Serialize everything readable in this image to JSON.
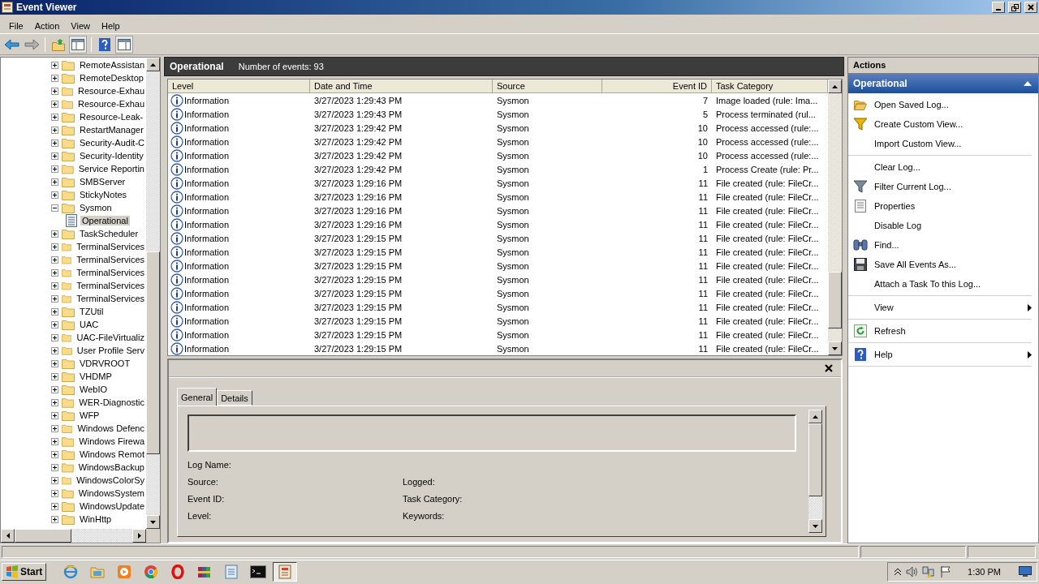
{
  "window": {
    "title": "Event Viewer"
  },
  "menu": [
    "File",
    "Action",
    "View",
    "Help"
  ],
  "tree": {
    "items": [
      {
        "label": "RemoteAssistan",
        "expanded": false,
        "selected": false
      },
      {
        "label": "RemoteDesktop",
        "expanded": false,
        "selected": false
      },
      {
        "label": "Resource-Exhau",
        "expanded": false,
        "selected": false
      },
      {
        "label": "Resource-Exhau",
        "expanded": false,
        "selected": false
      },
      {
        "label": "Resource-Leak-",
        "expanded": false,
        "selected": false
      },
      {
        "label": "RestartManager",
        "expanded": false,
        "selected": false
      },
      {
        "label": "Security-Audit-C",
        "expanded": false,
        "selected": false
      },
      {
        "label": "Security-Identity",
        "expanded": false,
        "selected": false
      },
      {
        "label": "Service Reportin",
        "expanded": false,
        "selected": false
      },
      {
        "label": "SMBServer",
        "expanded": false,
        "selected": false
      },
      {
        "label": "StickyNotes",
        "expanded": false,
        "selected": false
      },
      {
        "label": "Sysmon",
        "expanded": true,
        "selected": false,
        "children": [
          {
            "label": "Operational",
            "selected": true
          }
        ]
      },
      {
        "label": "TaskScheduler",
        "expanded": false,
        "selected": false
      },
      {
        "label": "TerminalServices",
        "expanded": false,
        "selected": false
      },
      {
        "label": "TerminalServices",
        "expanded": false,
        "selected": false
      },
      {
        "label": "TerminalServices",
        "expanded": false,
        "selected": false
      },
      {
        "label": "TerminalServices",
        "expanded": false,
        "selected": false
      },
      {
        "label": "TerminalServices",
        "expanded": false,
        "selected": false
      },
      {
        "label": "TZUtil",
        "expanded": false,
        "selected": false
      },
      {
        "label": "UAC",
        "expanded": false,
        "selected": false
      },
      {
        "label": "UAC-FileVirtualiz",
        "expanded": false,
        "selected": false
      },
      {
        "label": "User Profile Serv",
        "expanded": false,
        "selected": false
      },
      {
        "label": "VDRVROOT",
        "expanded": false,
        "selected": false
      },
      {
        "label": "VHDMP",
        "expanded": false,
        "selected": false
      },
      {
        "label": "WebIO",
        "expanded": false,
        "selected": false
      },
      {
        "label": "WER-Diagnostic",
        "expanded": false,
        "selected": false
      },
      {
        "label": "WFP",
        "expanded": false,
        "selected": false
      },
      {
        "label": "Windows Defenc",
        "expanded": false,
        "selected": false
      },
      {
        "label": "Windows Firewa",
        "expanded": false,
        "selected": false
      },
      {
        "label": "Windows Remot",
        "expanded": false,
        "selected": false
      },
      {
        "label": "WindowsBackup",
        "expanded": false,
        "selected": false
      },
      {
        "label": "WindowsColorSy",
        "expanded": false,
        "selected": false
      },
      {
        "label": "WindowsSystem",
        "expanded": false,
        "selected": false
      },
      {
        "label": "WindowsUpdate",
        "expanded": false,
        "selected": false
      },
      {
        "label": "WinHttp",
        "expanded": false,
        "selected": false
      }
    ]
  },
  "log_header": {
    "title": "Operational",
    "count": "Number of events: 93"
  },
  "table": {
    "columns": [
      "Level",
      "Date and Time",
      "Source",
      "Event ID",
      "Task Category"
    ],
    "rows": [
      {
        "level": "Information",
        "date_time": "3/27/2023 1:29:43 PM",
        "source": "Sysmon",
        "event_id": "7",
        "task_category": "Image loaded (rule: Ima...",
        "selected": false
      },
      {
        "level": "Information",
        "date_time": "3/27/2023 1:29:43 PM",
        "source": "Sysmon",
        "event_id": "5",
        "task_category": "Process terminated (rul...",
        "selected": false
      },
      {
        "level": "Information",
        "date_time": "3/27/2023 1:29:42 PM",
        "source": "Sysmon",
        "event_id": "10",
        "task_category": "Process accessed (rule:...",
        "selected": false
      },
      {
        "level": "Information",
        "date_time": "3/27/2023 1:29:42 PM",
        "source": "Sysmon",
        "event_id": "10",
        "task_category": "Process accessed (rule:...",
        "selected": false
      },
      {
        "level": "Information",
        "date_time": "3/27/2023 1:29:42 PM",
        "source": "Sysmon",
        "event_id": "10",
        "task_category": "Process accessed (rule:...",
        "selected": false
      },
      {
        "level": "Information",
        "date_time": "3/27/2023 1:29:42 PM",
        "source": "Sysmon",
        "event_id": "1",
        "task_category": "Process Create (rule: Pr...",
        "selected": false
      },
      {
        "level": "Information",
        "date_time": "3/27/2023 1:29:16 PM",
        "source": "Sysmon",
        "event_id": "11",
        "task_category": "File created (rule: FileCr...",
        "selected": false
      },
      {
        "level": "Information",
        "date_time": "3/27/2023 1:29:16 PM",
        "source": "Sysmon",
        "event_id": "11",
        "task_category": "File created (rule: FileCr...",
        "selected": false
      },
      {
        "level": "Information",
        "date_time": "3/27/2023 1:29:16 PM",
        "source": "Sysmon",
        "event_id": "11",
        "task_category": "File created (rule: FileCr...",
        "selected": false
      },
      {
        "level": "Information",
        "date_time": "3/27/2023 1:29:16 PM",
        "source": "Sysmon",
        "event_id": "11",
        "task_category": "File created (rule: FileCr...",
        "selected": false
      },
      {
        "level": "Information",
        "date_time": "3/27/2023 1:29:15 PM",
        "source": "Sysmon",
        "event_id": "11",
        "task_category": "File created (rule: FileCr...",
        "selected": false
      },
      {
        "level": "Information",
        "date_time": "3/27/2023 1:29:15 PM",
        "source": "Sysmon",
        "event_id": "11",
        "task_category": "File created (rule: FileCr...",
        "selected": false
      },
      {
        "level": "Information",
        "date_time": "3/27/2023 1:29:15 PM",
        "source": "Sysmon",
        "event_id": "11",
        "task_category": "File created (rule: FileCr...",
        "selected": false
      },
      {
        "level": "Information",
        "date_time": "3/27/2023 1:29:15 PM",
        "source": "Sysmon",
        "event_id": "11",
        "task_category": "File created (rule: FileCr...",
        "selected": false
      },
      {
        "level": "Information",
        "date_time": "3/27/2023 1:29:15 PM",
        "source": "Sysmon",
        "event_id": "11",
        "task_category": "File created (rule: FileCr...",
        "selected": false
      },
      {
        "level": "Information",
        "date_time": "3/27/2023 1:29:15 PM",
        "source": "Sysmon",
        "event_id": "11",
        "task_category": "File created (rule: FileCr...",
        "selected": false
      },
      {
        "level": "Information",
        "date_time": "3/27/2023 1:29:15 PM",
        "source": "Sysmon",
        "event_id": "11",
        "task_category": "File created (rule: FileCr...",
        "selected": false
      },
      {
        "level": "Information",
        "date_time": "3/27/2023 1:29:15 PM",
        "source": "Sysmon",
        "event_id": "11",
        "task_category": "File created (rule: FileCr...",
        "selected": false
      },
      {
        "level": "Information",
        "date_time": "3/27/2023 1:29:15 PM",
        "source": "Sysmon",
        "event_id": "11",
        "task_category": "File created (rule: FileCr...",
        "selected": false
      }
    ]
  },
  "details": {
    "tabs": [
      {
        "label": "General",
        "selected": true
      },
      {
        "label": "Details",
        "selected": false
      }
    ],
    "left_fields": [
      "Log Name:",
      "Source:",
      "Event ID:",
      "Level:"
    ],
    "right_fields": [
      "Logged:",
      "Task Category:",
      "Keywords:"
    ]
  },
  "actions": {
    "title": "Actions",
    "section": "Operational",
    "groups": [
      [
        {
          "label": "Open Saved Log...",
          "submenu": false
        },
        {
          "label": "Create Custom View...",
          "submenu": false
        },
        {
          "label": "Import Custom View...",
          "submenu": false
        }
      ],
      [
        {
          "label": "Clear Log...",
          "submenu": false
        },
        {
          "label": "Filter Current Log...",
          "submenu": false
        },
        {
          "label": "Properties",
          "submenu": false
        },
        {
          "label": "Disable Log",
          "submenu": false
        },
        {
          "label": "Find...",
          "submenu": false
        },
        {
          "label": "Save All Events As...",
          "submenu": false
        },
        {
          "label": "Attach a Task To this Log...",
          "submenu": false
        }
      ],
      [
        {
          "label": "View",
          "submenu": true
        }
      ],
      [
        {
          "label": "Refresh",
          "submenu": false
        }
      ],
      [
        {
          "label": "Help",
          "submenu": true
        }
      ]
    ]
  },
  "taskbar": {
    "start": "Start",
    "clock": "1:30 PM"
  }
}
